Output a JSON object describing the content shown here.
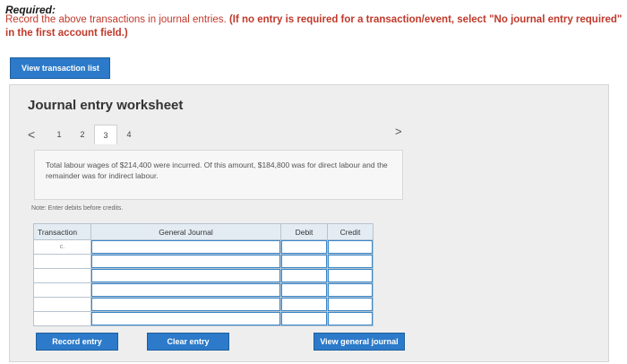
{
  "header": {
    "required_label": "Required:",
    "instruction_main": "Record the above transactions in journal entries. ",
    "instruction_emph": "(If no entry is required for a transaction/event, select \"No journal entry required\" in the first account field.)"
  },
  "buttons": {
    "view_transaction_list": "View transaction list",
    "record_entry": "Record entry",
    "clear_entry": "Clear entry",
    "view_general_journal": "View general journal"
  },
  "worksheet": {
    "title": "Journal entry worksheet",
    "pages": [
      "1",
      "2",
      "3",
      "4"
    ],
    "active_page": "3",
    "prev_icon": "<",
    "next_icon": ">",
    "description": "Total labour wages of $214,400 were incurred. Of this amount, $184,800 was for direct labour and the remainder was for indirect labour.",
    "note": "Note: Enter debits before credits."
  },
  "journal": {
    "headers": {
      "transaction": "Transaction",
      "general_journal": "General Journal",
      "debit": "Debit",
      "credit": "Credit"
    },
    "first_row_transaction": "c."
  }
}
